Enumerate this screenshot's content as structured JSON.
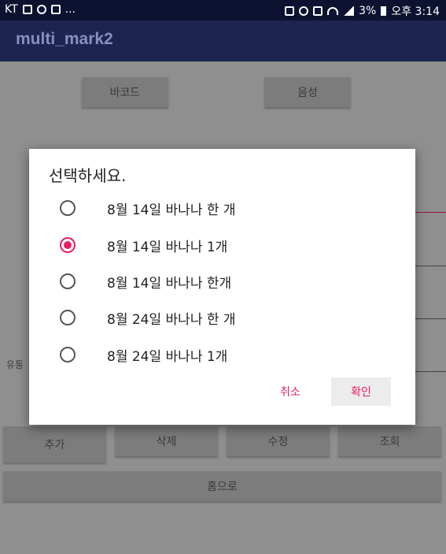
{
  "statusbar": {
    "carrier": "KT",
    "left_extra": "...",
    "battery": "3%",
    "time": "오후 3:14"
  },
  "app": {
    "title": "multi_mark2"
  },
  "background": {
    "top_buttons": [
      "바코드",
      "음성"
    ],
    "field_label": "유통",
    "bottom_buttons": [
      "추가",
      "삭제",
      "수정",
      "조회"
    ],
    "home_button": "홈으로"
  },
  "dialog": {
    "title": "선택하세요.",
    "options": [
      {
        "label": "8월 14일 바나나 한 개",
        "checked": false
      },
      {
        "label": "8월 14일 바나나 1개",
        "checked": true
      },
      {
        "label": "8월 14일 바나나 한개",
        "checked": false
      },
      {
        "label": "8월 24일 바나나 한 개",
        "checked": false
      },
      {
        "label": "8월 24일 바나나 1개",
        "checked": false
      }
    ],
    "cancel_label": "취소",
    "ok_label": "확인"
  },
  "colors": {
    "accent": "#e91e63",
    "appbar": "#1d2450",
    "statusbar": "#0d1230",
    "scrim": "#8f8f8f"
  }
}
